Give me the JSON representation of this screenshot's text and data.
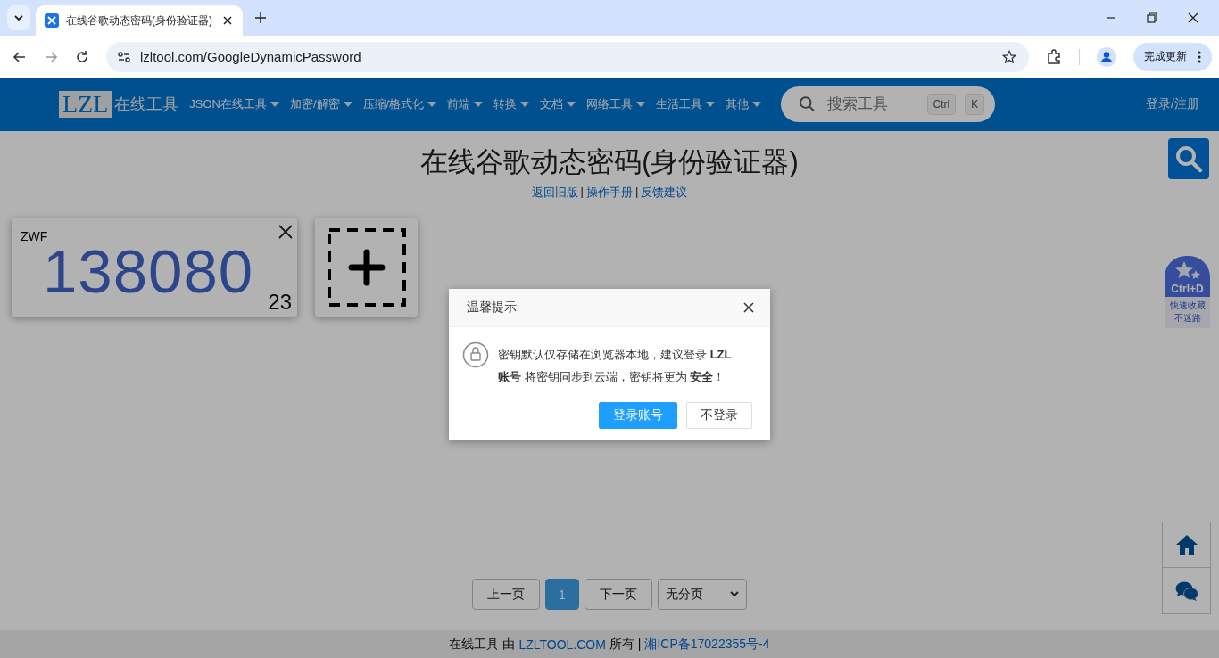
{
  "browser": {
    "tab": {
      "title": "在线谷歌动态密码(身份验证器)",
      "selected": true
    },
    "url": "lzltool.com/GoogleDynamicPassword",
    "update_button": "完成更新"
  },
  "header": {
    "logo": {
      "mark": "LZL",
      "text": "在线工具"
    },
    "nav": [
      {
        "label": "JSON在线工具"
      },
      {
        "label": "加密/解密"
      },
      {
        "label": "压缩/格式化"
      },
      {
        "label": "前端"
      },
      {
        "label": "转换"
      },
      {
        "label": "文档"
      },
      {
        "label": "网络工具"
      },
      {
        "label": "生活工具"
      },
      {
        "label": "其他"
      }
    ],
    "search": {
      "placeholder": "搜索工具",
      "keys": [
        "Ctrl",
        "K"
      ]
    },
    "login": "登录/注册"
  },
  "page": {
    "title": "在线谷歌动态密码(身份验证器)",
    "links": [
      "返回旧版",
      "操作手册",
      "反馈建议"
    ],
    "link_separator": "|",
    "cards": [
      {
        "name": "ZWF",
        "code": "138080",
        "seconds": "23"
      }
    ],
    "pagination": {
      "prev": "上一页",
      "pages": [
        {
          "label": "1",
          "selected": true
        }
      ],
      "next": "下一页",
      "mode": "无分页"
    }
  },
  "side": {
    "bookmark": {
      "keys": "Ctrl+D",
      "text": "快速收藏不迷路"
    }
  },
  "footer": {
    "text": "在线工具 由",
    "site": "LZLTOOL.COM",
    "owned": "所有 |",
    "icp": "湘ICP备17022355号-4"
  },
  "dialog": {
    "title": "温馨提示",
    "message": "密钥默认仅存储在浏览器本地，建议登录 **LZL账号** 将密钥同步到云端，密钥将更为 **安全**！",
    "buttons": [
      {
        "label": "登录账号",
        "kind": "primary"
      },
      {
        "label": "不登录",
        "kind": "plain"
      }
    ]
  }
}
